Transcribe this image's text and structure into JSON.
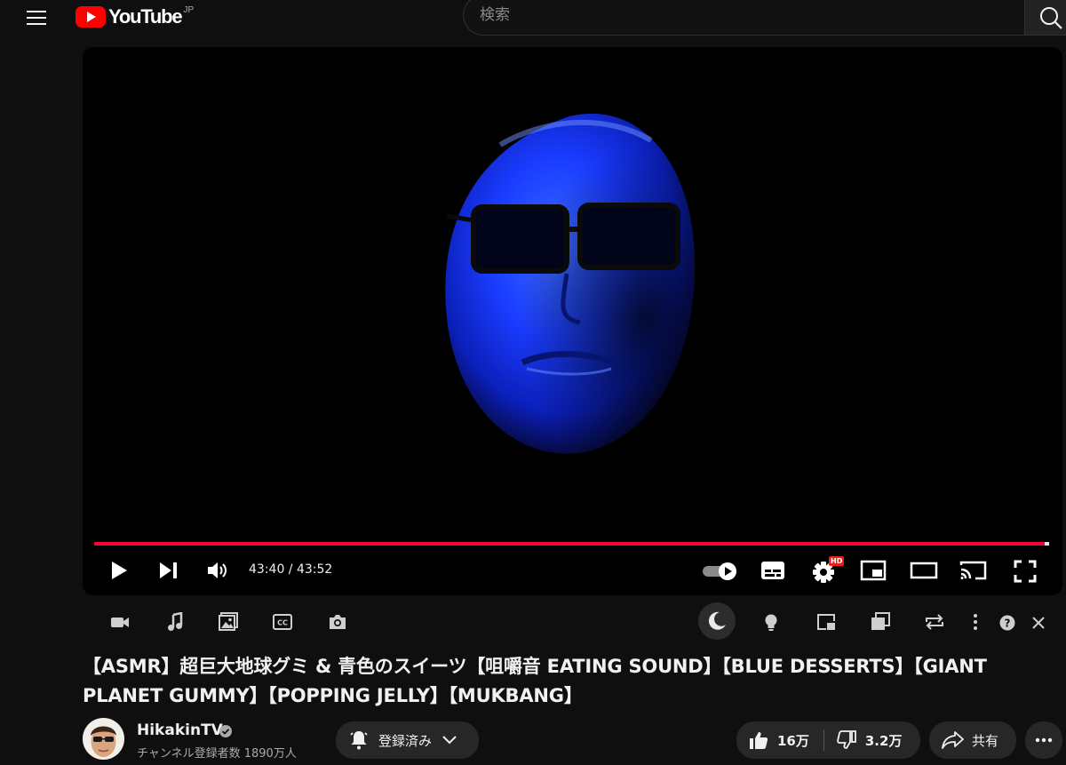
{
  "header": {
    "logo_text": "YouTube",
    "region": "JP",
    "search_placeholder": "検索"
  },
  "player": {
    "current_time": "43:40",
    "duration": "43:52",
    "time_display": "43:40 / 43:52",
    "progress_fraction": 0.995,
    "quality_badge": "HD",
    "autoplay_on": true
  },
  "video": {
    "title": "【ASMR】超巨大地球グミ & 青色のスイーツ【咀嚼音 EATING SOUND】【BLUE DESSERTS】【GIANT PLANET GUMMY】【POPPING JELLY】【MUKBANG】"
  },
  "channel": {
    "name": "HikakinTV",
    "subscribers": "チャンネル登録者数 1890万人",
    "subscribe_label": "登録済み"
  },
  "actions": {
    "likes": "16万",
    "dislikes": "3.2万",
    "share_label": "共有"
  },
  "colors": {
    "accent": "#ff0033",
    "background": "#0f0f0f",
    "face_blue": "#1a3cff"
  }
}
